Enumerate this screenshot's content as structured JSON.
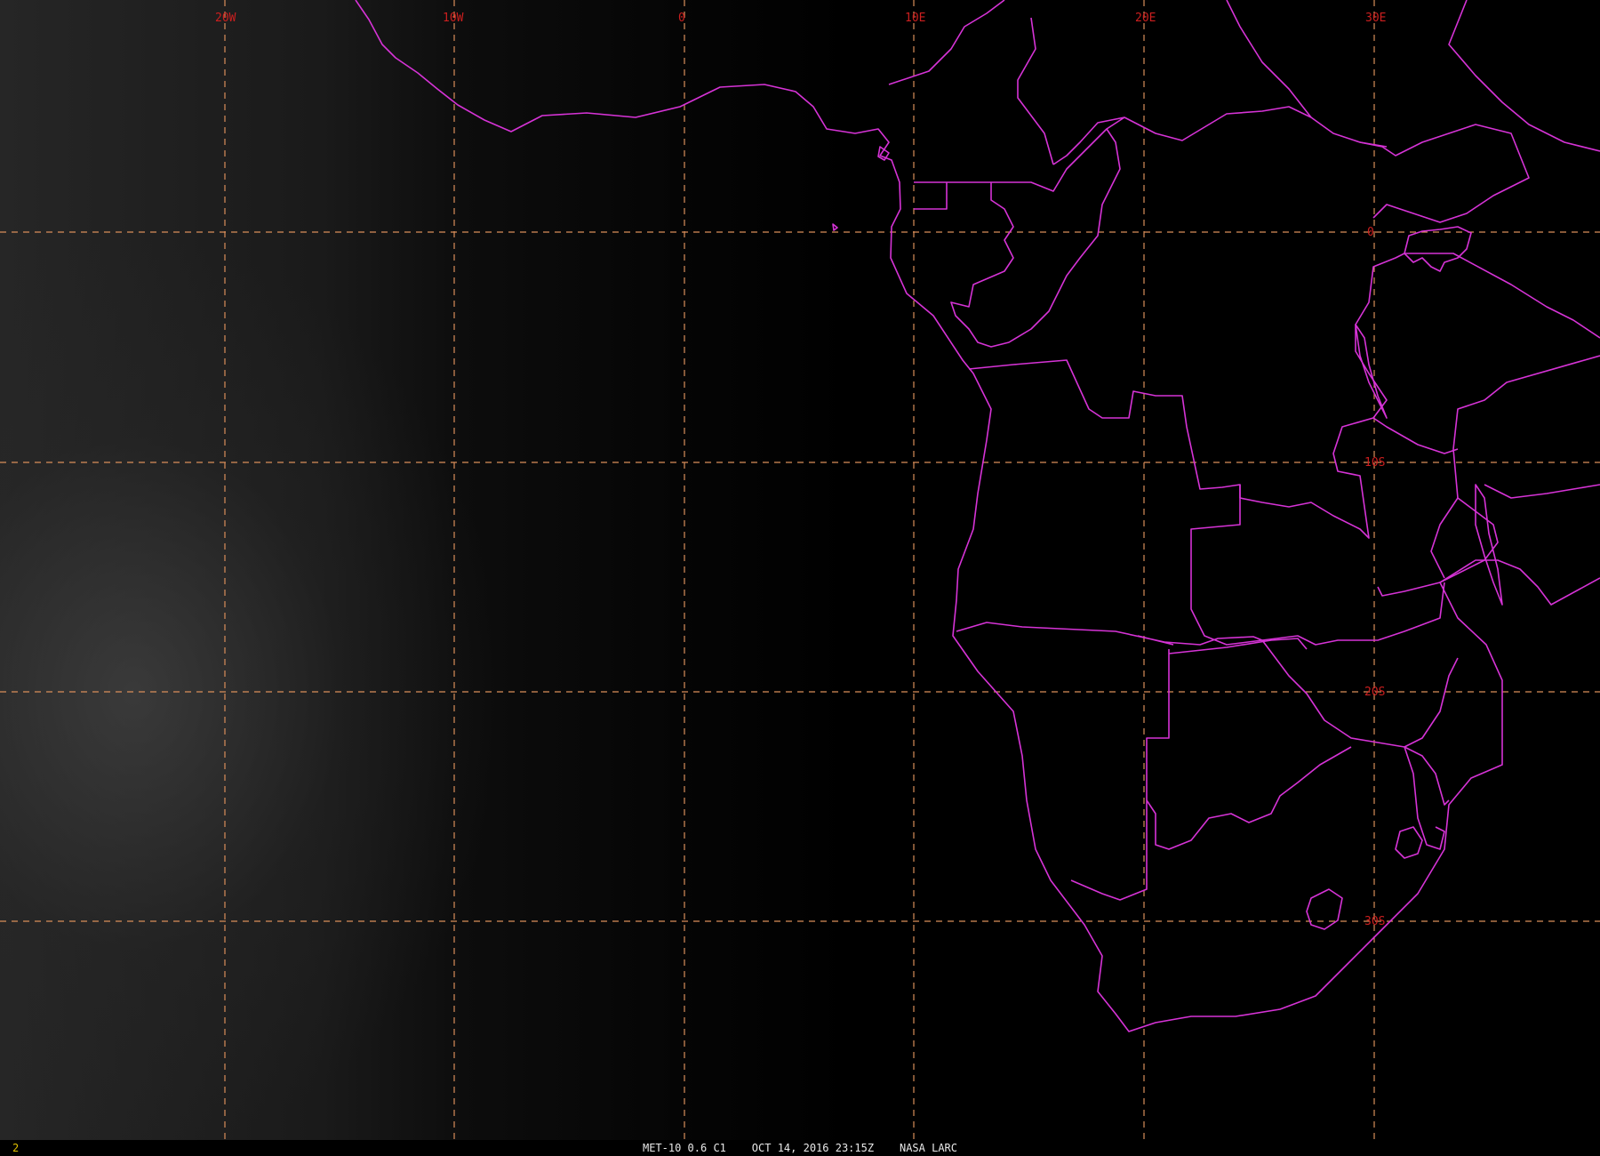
{
  "map": {
    "longitude_labels": [
      "20W",
      "10W",
      "0",
      "10E",
      "20E",
      "30E"
    ],
    "latitude_labels": [
      "0",
      "10S",
      "20S",
      "30S"
    ],
    "colors": {
      "background": "#000000",
      "grid": "#d98e5a",
      "borders": "#d633d6",
      "labels": "#cc1f1f"
    }
  },
  "status": {
    "frame": "2",
    "caption": "MET-10 0.6 C1    OCT 14, 2016 23:15Z    NASA LARC"
  }
}
